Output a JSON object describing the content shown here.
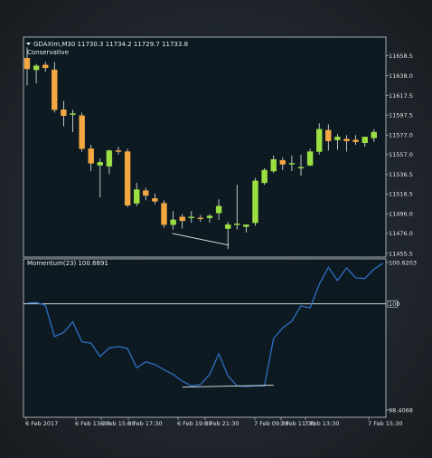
{
  "header": {
    "symbol_line": "GDAXIm,M30  11730.3 11734.2 11729.7 11733.8",
    "indicator_name": "Conservative"
  },
  "momentum_panel": {
    "label": "Momentum(23) 100.6891",
    "level_label": "100"
  },
  "colors": {
    "background": "#0d1a22",
    "bull": "#9be041",
    "bear": "#f5a742",
    "momentum_line": "#2f6fc0",
    "grid": "#c9cfd4"
  },
  "chart_data": [
    {
      "type": "candlestick",
      "symbol": "GDAXIm",
      "timeframe": "M30",
      "price_ticks": [
        "11658.5",
        "11638.0",
        "11617.5",
        "11597.5",
        "11577.0",
        "11557.0",
        "11536.5",
        "11516.5",
        "11496.0",
        "11476.0",
        "11455.5"
      ],
      "ylim": [
        11455.5,
        11658.5
      ],
      "time_ticks": [
        "6 Feb 2017",
        "6 Feb 13:30",
        "6 Feb 15:30",
        "6 Feb 17:30",
        "6 Feb 19:30",
        "6 Feb 21:30",
        "7 Feb 09:30",
        "7 Feb 11:30",
        "7 Feb 13:30",
        "7 Feb 15:30"
      ],
      "candles": [
        {
          "o": 11656,
          "h": 11667,
          "l": 11628,
          "c": 11645
        },
        {
          "o": 11644,
          "h": 11650,
          "l": 11630,
          "c": 11648
        },
        {
          "o": 11649,
          "h": 11652,
          "l": 11642,
          "c": 11646
        },
        {
          "o": 11644,
          "h": 11652,
          "l": 11600,
          "c": 11603
        },
        {
          "o": 11603,
          "h": 11612,
          "l": 11586,
          "c": 11597
        },
        {
          "o": 11598,
          "h": 11603,
          "l": 11580,
          "c": 11599
        },
        {
          "o": 11597,
          "h": 11600,
          "l": 11560,
          "c": 11563
        },
        {
          "o": 11563,
          "h": 11567,
          "l": 11540,
          "c": 11548
        },
        {
          "o": 11546,
          "h": 11553,
          "l": 11513,
          "c": 11549
        },
        {
          "o": 11545,
          "h": 11562,
          "l": 11537,
          "c": 11561
        },
        {
          "o": 11561,
          "h": 11565,
          "l": 11557,
          "c": 11560
        },
        {
          "o": 11560,
          "h": 11563,
          "l": 11503,
          "c": 11505
        },
        {
          "o": 11507,
          "h": 11528,
          "l": 11504,
          "c": 11521
        },
        {
          "o": 11520,
          "h": 11523,
          "l": 11510,
          "c": 11515
        },
        {
          "o": 11512,
          "h": 11517,
          "l": 11506,
          "c": 11509
        },
        {
          "o": 11507,
          "h": 11510,
          "l": 11482,
          "c": 11485
        },
        {
          "o": 11485,
          "h": 11499,
          "l": 11480,
          "c": 11490
        },
        {
          "o": 11493,
          "h": 11496,
          "l": 11481,
          "c": 11489
        },
        {
          "o": 11492,
          "h": 11499,
          "l": 11487,
          "c": 11493
        },
        {
          "o": 11492,
          "h": 11495,
          "l": 11488,
          "c": 11491
        },
        {
          "o": 11492,
          "h": 11496,
          "l": 11487,
          "c": 11494
        },
        {
          "o": 11497,
          "h": 11511,
          "l": 11490,
          "c": 11504
        },
        {
          "o": 11481,
          "h": 11488,
          "l": 11460,
          "c": 11485
        },
        {
          "o": 11485,
          "h": 11526,
          "l": 11480,
          "c": 11486
        },
        {
          "o": 11483,
          "h": 11485,
          "l": 11477,
          "c": 11485
        },
        {
          "o": 11487,
          "h": 11533,
          "l": 11484,
          "c": 11530
        },
        {
          "o": 11528,
          "h": 11543,
          "l": 11526,
          "c": 11541
        },
        {
          "o": 11540,
          "h": 11556,
          "l": 11538,
          "c": 11552
        },
        {
          "o": 11551,
          "h": 11554,
          "l": 11541,
          "c": 11547
        },
        {
          "o": 11548,
          "h": 11556,
          "l": 11540,
          "c": 11548
        },
        {
          "o": 11543,
          "h": 11557,
          "l": 11535,
          "c": 11544
        },
        {
          "o": 11546,
          "h": 11563,
          "l": 11545,
          "c": 11560
        },
        {
          "o": 11560,
          "h": 11589,
          "l": 11557,
          "c": 11583
        },
        {
          "o": 11582,
          "h": 11588,
          "l": 11561,
          "c": 11571
        },
        {
          "o": 11572,
          "h": 11578,
          "l": 11562,
          "c": 11575
        },
        {
          "o": 11573,
          "h": 11577,
          "l": 11560,
          "c": 11571
        },
        {
          "o": 11572,
          "h": 11577,
          "l": 11567,
          "c": 11570
        },
        {
          "o": 11569,
          "h": 11575,
          "l": 11565,
          "c": 11575
        },
        {
          "o": 11574,
          "h": 11583,
          "l": 11570,
          "c": 11580
        }
      ],
      "trendline": {
        "from_candle": 16,
        "from_price": 11476,
        "to_candle": 22,
        "to_price": 11464
      }
    },
    {
      "type": "line",
      "title": "Momentum(23) 100.6891",
      "ylim": [
        98.4068,
        100.6203
      ],
      "y_ticks": [
        "100.6203",
        "100",
        "98.4068"
      ],
      "level": 100,
      "x": [
        0,
        1,
        2,
        3,
        4,
        5,
        6,
        7,
        8,
        9,
        10,
        11,
        12,
        13,
        14,
        15,
        16,
        17,
        18,
        19,
        20,
        21,
        22,
        23,
        24,
        25,
        26,
        27,
        28,
        29,
        30,
        31,
        32,
        33,
        34,
        35,
        36,
        37,
        38,
        39
      ],
      "values": [
        100.01,
        100.02,
        99.98,
        99.51,
        99.57,
        99.73,
        99.43,
        99.41,
        99.21,
        99.34,
        99.36,
        99.33,
        99.04,
        99.13,
        99.09,
        99.01,
        98.94,
        98.84,
        98.77,
        98.79,
        98.94,
        99.25,
        98.92,
        98.77,
        98.76,
        98.77,
        98.77,
        99.48,
        99.64,
        99.74,
        99.97,
        99.94,
        100.29,
        100.55,
        100.35,
        100.54,
        100.39,
        100.38,
        100.52,
        100.61
      ],
      "trendline": {
        "from": [
          17,
          98.75
        ],
        "to": [
          27,
          98.78
        ]
      }
    }
  ]
}
